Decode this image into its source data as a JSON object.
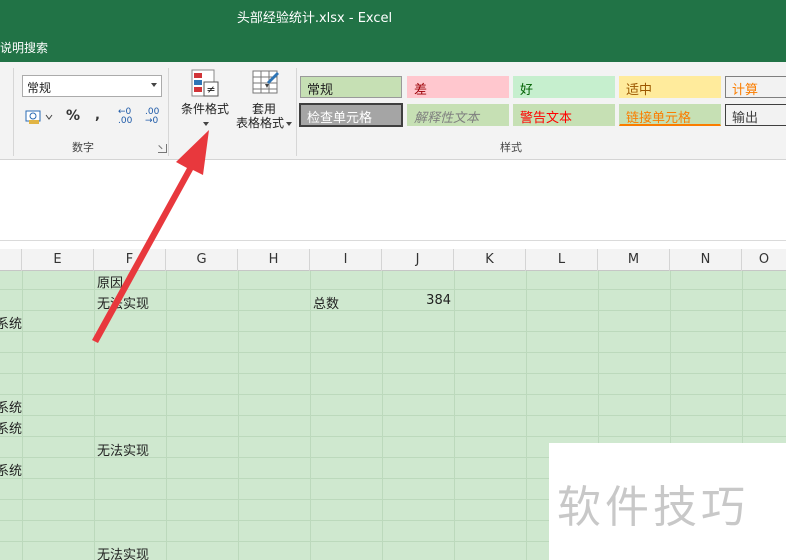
{
  "window": {
    "title": "头部经验统计.xlsx  -  Excel"
  },
  "menubar": {
    "tell_me": "说明搜索"
  },
  "ribbon": {
    "number_format": "常规",
    "number_group_label": "数字",
    "styles_group_label": "样式",
    "conditional_format": "条件格式",
    "table_format_line1": "套用",
    "table_format_line2": "表格格式",
    "icons": {
      "accounting": "accounting-format-icon",
      "percent": "%",
      "comma": ",",
      "inc_decimal_top": "←0",
      "inc_decimal_bottom": ".00",
      "dec_decimal_top": ".00",
      "dec_decimal_bottom": "→0"
    },
    "styles": [
      {
        "label": "常规",
        "bg": "#c6e0b4",
        "color": "#222222",
        "border": "#9a9a9a"
      },
      {
        "label": "差",
        "bg": "#ffc7ce",
        "color": "#9c0006",
        "border": "#ffc7ce"
      },
      {
        "label": "好",
        "bg": "#c6efce",
        "color": "#006100",
        "border": "#c6efce"
      },
      {
        "label": "适中",
        "bg": "#ffeb9c",
        "color": "#9c5700",
        "border": "#ffeb9c"
      },
      {
        "label": "计算",
        "bg": "#f2f2f2",
        "color": "#fa7d00",
        "border": "#7f7f7f"
      },
      {
        "label": "检查单元格",
        "bg": "#a5a5a5",
        "color": "#ffffff",
        "border": "#3f3f3f"
      },
      {
        "label": "解释性文本",
        "bg": "#c6e0b4",
        "color": "#7f7f7f",
        "border": "#c6e0b4"
      },
      {
        "label": "警告文本",
        "bg": "#c6e0b4",
        "color": "#ff0000",
        "border": "#c6e0b4"
      },
      {
        "label": "链接单元格",
        "bg": "#c6e0b4",
        "color": "#fa7d00",
        "border": "#c6e0b4"
      },
      {
        "label": "输出",
        "bg": "#f2f2f2",
        "color": "#3f3f3f",
        "border": "#3f3f3f"
      }
    ]
  },
  "columns": [
    "E",
    "F",
    "G",
    "H",
    "I",
    "J",
    "K",
    "L",
    "M",
    "N",
    "O"
  ],
  "cells": {
    "f_header": "原因",
    "f_row2": "无法实现",
    "i_row2": "总数",
    "j_row2": "384",
    "a_row3": "系统",
    "a_row7": "系统",
    "a_row8": "系统",
    "f_row9": "无法实现",
    "a_row10": "系统",
    "f_last": "无法实现"
  },
  "watermark": "软件技巧",
  "colors": {
    "excel_green": "#217346",
    "grid_fill": "#cfe8cf",
    "arrow": "#e8383d"
  }
}
